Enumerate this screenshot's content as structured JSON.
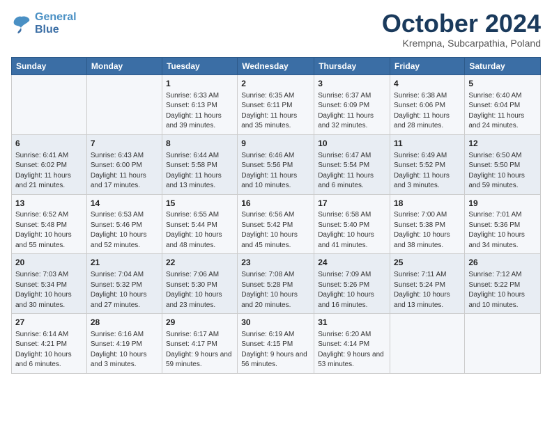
{
  "header": {
    "logo_line1": "General",
    "logo_line2": "Blue",
    "month_title": "October 2024",
    "subtitle": "Krempna, Subcarpathia, Poland"
  },
  "weekdays": [
    "Sunday",
    "Monday",
    "Tuesday",
    "Wednesday",
    "Thursday",
    "Friday",
    "Saturday"
  ],
  "weeks": [
    [
      {
        "day": "",
        "info": ""
      },
      {
        "day": "",
        "info": ""
      },
      {
        "day": "1",
        "info": "Sunrise: 6:33 AM\nSunset: 6:13 PM\nDaylight: 11 hours and 39 minutes."
      },
      {
        "day": "2",
        "info": "Sunrise: 6:35 AM\nSunset: 6:11 PM\nDaylight: 11 hours and 35 minutes."
      },
      {
        "day": "3",
        "info": "Sunrise: 6:37 AM\nSunset: 6:09 PM\nDaylight: 11 hours and 32 minutes."
      },
      {
        "day": "4",
        "info": "Sunrise: 6:38 AM\nSunset: 6:06 PM\nDaylight: 11 hours and 28 minutes."
      },
      {
        "day": "5",
        "info": "Sunrise: 6:40 AM\nSunset: 6:04 PM\nDaylight: 11 hours and 24 minutes."
      }
    ],
    [
      {
        "day": "6",
        "info": "Sunrise: 6:41 AM\nSunset: 6:02 PM\nDaylight: 11 hours and 21 minutes."
      },
      {
        "day": "7",
        "info": "Sunrise: 6:43 AM\nSunset: 6:00 PM\nDaylight: 11 hours and 17 minutes."
      },
      {
        "day": "8",
        "info": "Sunrise: 6:44 AM\nSunset: 5:58 PM\nDaylight: 11 hours and 13 minutes."
      },
      {
        "day": "9",
        "info": "Sunrise: 6:46 AM\nSunset: 5:56 PM\nDaylight: 11 hours and 10 minutes."
      },
      {
        "day": "10",
        "info": "Sunrise: 6:47 AM\nSunset: 5:54 PM\nDaylight: 11 hours and 6 minutes."
      },
      {
        "day": "11",
        "info": "Sunrise: 6:49 AM\nSunset: 5:52 PM\nDaylight: 11 hours and 3 minutes."
      },
      {
        "day": "12",
        "info": "Sunrise: 6:50 AM\nSunset: 5:50 PM\nDaylight: 10 hours and 59 minutes."
      }
    ],
    [
      {
        "day": "13",
        "info": "Sunrise: 6:52 AM\nSunset: 5:48 PM\nDaylight: 10 hours and 55 minutes."
      },
      {
        "day": "14",
        "info": "Sunrise: 6:53 AM\nSunset: 5:46 PM\nDaylight: 10 hours and 52 minutes."
      },
      {
        "day": "15",
        "info": "Sunrise: 6:55 AM\nSunset: 5:44 PM\nDaylight: 10 hours and 48 minutes."
      },
      {
        "day": "16",
        "info": "Sunrise: 6:56 AM\nSunset: 5:42 PM\nDaylight: 10 hours and 45 minutes."
      },
      {
        "day": "17",
        "info": "Sunrise: 6:58 AM\nSunset: 5:40 PM\nDaylight: 10 hours and 41 minutes."
      },
      {
        "day": "18",
        "info": "Sunrise: 7:00 AM\nSunset: 5:38 PM\nDaylight: 10 hours and 38 minutes."
      },
      {
        "day": "19",
        "info": "Sunrise: 7:01 AM\nSunset: 5:36 PM\nDaylight: 10 hours and 34 minutes."
      }
    ],
    [
      {
        "day": "20",
        "info": "Sunrise: 7:03 AM\nSunset: 5:34 PM\nDaylight: 10 hours and 30 minutes."
      },
      {
        "day": "21",
        "info": "Sunrise: 7:04 AM\nSunset: 5:32 PM\nDaylight: 10 hours and 27 minutes."
      },
      {
        "day": "22",
        "info": "Sunrise: 7:06 AM\nSunset: 5:30 PM\nDaylight: 10 hours and 23 minutes."
      },
      {
        "day": "23",
        "info": "Sunrise: 7:08 AM\nSunset: 5:28 PM\nDaylight: 10 hours and 20 minutes."
      },
      {
        "day": "24",
        "info": "Sunrise: 7:09 AM\nSunset: 5:26 PM\nDaylight: 10 hours and 16 minutes."
      },
      {
        "day": "25",
        "info": "Sunrise: 7:11 AM\nSunset: 5:24 PM\nDaylight: 10 hours and 13 minutes."
      },
      {
        "day": "26",
        "info": "Sunrise: 7:12 AM\nSunset: 5:22 PM\nDaylight: 10 hours and 10 minutes."
      }
    ],
    [
      {
        "day": "27",
        "info": "Sunrise: 6:14 AM\nSunset: 4:21 PM\nDaylight: 10 hours and 6 minutes."
      },
      {
        "day": "28",
        "info": "Sunrise: 6:16 AM\nSunset: 4:19 PM\nDaylight: 10 hours and 3 minutes."
      },
      {
        "day": "29",
        "info": "Sunrise: 6:17 AM\nSunset: 4:17 PM\nDaylight: 9 hours and 59 minutes."
      },
      {
        "day": "30",
        "info": "Sunrise: 6:19 AM\nSunset: 4:15 PM\nDaylight: 9 hours and 56 minutes."
      },
      {
        "day": "31",
        "info": "Sunrise: 6:20 AM\nSunset: 4:14 PM\nDaylight: 9 hours and 53 minutes."
      },
      {
        "day": "",
        "info": ""
      },
      {
        "day": "",
        "info": ""
      }
    ]
  ]
}
